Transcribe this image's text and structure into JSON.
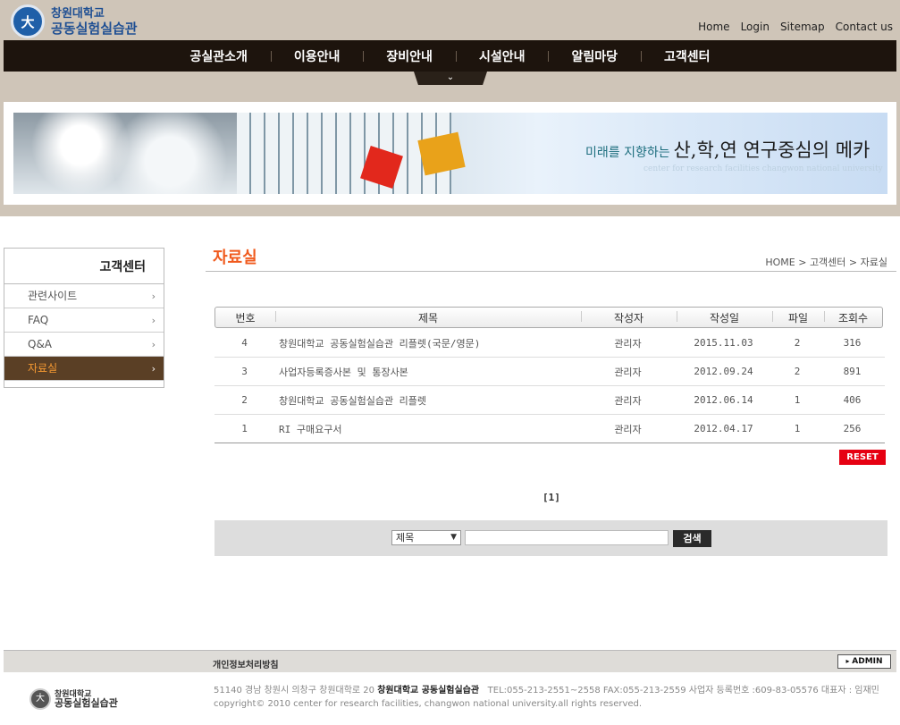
{
  "header": {
    "logo_line1": "창원대학교",
    "logo_line2": "공동실험실습관",
    "util_links": [
      "Home",
      "Login",
      "Sitemap",
      "Contact us"
    ],
    "gnb": [
      "공실관소개",
      "이용안내",
      "장비안내",
      "시설안내",
      "알림마당",
      "고객센터"
    ]
  },
  "banner": {
    "slogan_prefix": "미래를 지향하는",
    "slogan_main": "산,학,연 연구중심의 메카",
    "slogan_sub": "center for research facilities changwon national university"
  },
  "sidebar": {
    "title": "고객센터",
    "items": [
      {
        "label": "관련사이트"
      },
      {
        "label": "FAQ"
      },
      {
        "label": "Q&A"
      },
      {
        "label": "자료실"
      }
    ]
  },
  "content": {
    "title": "자료실",
    "breadcrumb": "HOME > 고객센터 > 자료실"
  },
  "table": {
    "columns": [
      "번호",
      "제목",
      "작성자",
      "작성일",
      "파일",
      "조회수"
    ],
    "rows": [
      {
        "no": "4",
        "title": "창원대학교 공동실험실습관 리플렛(국문/영문)",
        "author": "관리자",
        "date": "2015.11.03",
        "files": "2",
        "views": "316"
      },
      {
        "no": "3",
        "title": "사업자등록증사본 및 통장사본",
        "author": "관리자",
        "date": "2012.09.24",
        "files": "2",
        "views": "891"
      },
      {
        "no": "2",
        "title": "창원대학교 공동실험실습관 리플렛",
        "author": "관리자",
        "date": "2012.06.14",
        "files": "1",
        "views": "406"
      },
      {
        "no": "1",
        "title": "RI 구매요구서",
        "author": "관리자",
        "date": "2012.04.17",
        "files": "1",
        "views": "256"
      }
    ]
  },
  "reset_label": "RESET",
  "paging": "[1]",
  "search": {
    "select_value": "제목",
    "input_value": "",
    "button_label": "검색"
  },
  "footer": {
    "policy": "개인정보처리방침",
    "admin_label": "ADMIN",
    "logo_line1": "창원대학교",
    "logo_line2": "공동실험실습관",
    "address_pre": "51140 경남 창원시 의창구 창원대학로 20",
    "org_name": "창원대학교 공동실험실습관",
    "address_post": "TEL:055-213-2551~2558   FAX:055-213-2559   사업자 등록번호 :609-83-05576   대표자 : 임재민",
    "copyright": "copyright© 2010 center for research facilities, changwon national university.all rights reserved."
  },
  "colors": {
    "accent": "#f05a1d",
    "nav_bg": "#1d140d",
    "header_bg": "#cfc5b8",
    "reset": "#e60012",
    "sidebar_active": "#5a3f25"
  }
}
